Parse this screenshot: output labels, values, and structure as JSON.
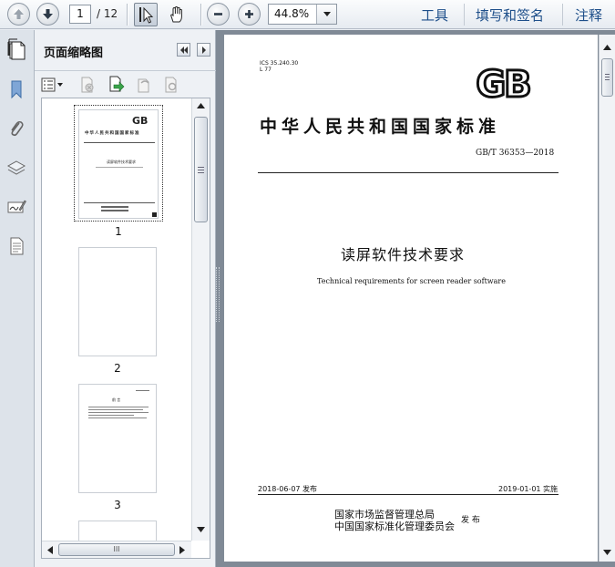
{
  "toolbar": {
    "page_current": "1",
    "page_total": "/ 12",
    "zoom": "44.8%",
    "menu": [
      "工具",
      "填写和签名",
      "注释"
    ]
  },
  "panel": {
    "title": "页面缩略图",
    "thumbnails": [
      {
        "label": "1"
      },
      {
        "label": "2"
      },
      {
        "label": "3"
      }
    ],
    "hscroll_grip": "III"
  },
  "document": {
    "ics": "ICS 35.240.30",
    "ccs": "L 77",
    "logo": "GB",
    "national_title": "中华人民共和国国家标准",
    "standard_number": "GB/T 36353—2018",
    "title_cn": "读屏软件技术要求",
    "title_en": "Technical requirements for screen reader software",
    "issue_date": "2018-06-07 发布",
    "implement_date": "2019-01-01 实施",
    "org_line1": "国家市场监督管理总局",
    "org_line2": "中国国家标准化管理委员会",
    "publish_label": "发 布"
  },
  "thumb1": {
    "national_title": "中华人民共和国国家标准",
    "title_cn": "读屏软件技术要求"
  },
  "thumb3": {
    "heading": "前  言"
  }
}
